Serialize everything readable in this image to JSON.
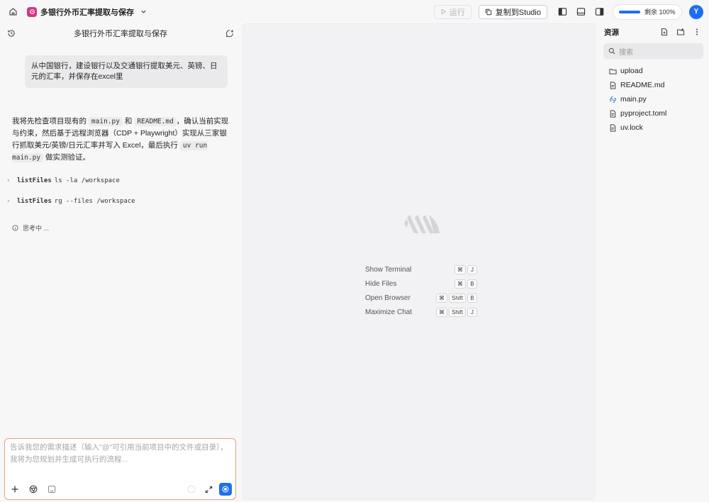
{
  "topbar": {
    "project_title": "多银行外币汇率提取与保存",
    "run_label": "运行",
    "copy_label": "复制到Studio",
    "quota_text": "剩余 100%",
    "quota_fraction": 1.0,
    "avatar_initial": "Y",
    "accent_color": "#1d6ff2",
    "project_logo_color": "#d63384"
  },
  "chat": {
    "title": "多银行外币汇率提取与保存",
    "user_message": "从中国银行，建设银行以及交通银行提取美元、英镑、日元的汇率，并保存在excel里",
    "assistant": {
      "p1": "我将先检查项目现有的",
      "code1": "main.py",
      "p2": "和",
      "code2": "README.md",
      "p3": "，确认当前实现与约束，然后基于远程浏览器（CDP + Playwright）实现从三家银行抓取美元/英镑/日元汇率并写入 Excel，最后执行",
      "code3": "uv run main.py",
      "p4": "做实测验证。"
    },
    "tools": [
      {
        "name": "listFiles",
        "args": "ls -la /workspace"
      },
      {
        "name": "listFiles",
        "args": "rg --files /workspace"
      }
    ],
    "thinking": "思考中 ...",
    "input_placeholder": "告诉我您的需求描述（输入\"@\"可引用当前项目中的文件或目录），我将为您规划并生成可执行的流程..."
  },
  "center": {
    "shortcuts": [
      {
        "label": "Show Terminal",
        "keys": [
          "⌘",
          "J"
        ]
      },
      {
        "label": "Hide Files",
        "keys": [
          "⌘",
          "B"
        ]
      },
      {
        "label": "Open Browser",
        "keys": [
          "⌘",
          "Shift",
          "B"
        ]
      },
      {
        "label": "Maximize Chat",
        "keys": [
          "⌘",
          "Shift",
          "J"
        ]
      }
    ]
  },
  "resources": {
    "title": "资源",
    "search_placeholder": "搜索",
    "files": [
      {
        "name": "upload",
        "icon": "folder-icon"
      },
      {
        "name": "README.md",
        "icon": "file-icon"
      },
      {
        "name": "main.py",
        "icon": "python-icon"
      },
      {
        "name": "pyproject.toml",
        "icon": "file-icon"
      },
      {
        "name": "uv.lock",
        "icon": "file-icon"
      }
    ]
  }
}
